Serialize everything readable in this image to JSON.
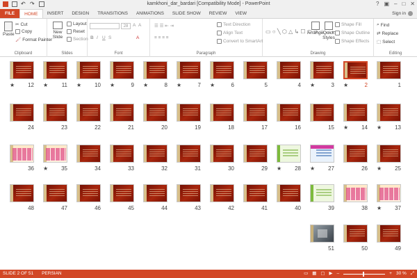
{
  "window": {
    "title": "kamkhoni_dar_bardari [Compatibility Mode] - PowerPoint"
  },
  "tabs": [
    "FILE",
    "HOME",
    "INSERT",
    "DESIGN",
    "TRANSITIONS",
    "ANIMATIONS",
    "SLIDE SHOW",
    "REVIEW",
    "VIEW"
  ],
  "account": {
    "signin": "Sign in"
  },
  "ribbon": {
    "clipboard": {
      "label": "Clipboard",
      "paste": "Paste",
      "cut": "Cut",
      "copy": "Copy",
      "format_painter": "Format Painter"
    },
    "slides": {
      "label": "Slides",
      "new_slide": "New Slide",
      "layout": "Layout",
      "reset": "Reset",
      "section": "Section"
    },
    "font": {
      "label": "Font",
      "size": "28"
    },
    "paragraph": {
      "label": "Paragraph",
      "text_direction": "Text Direction",
      "align_text": "Align Text",
      "convert": "Convert to SmartArt"
    },
    "drawing": {
      "label": "Drawing",
      "arrange": "Arrange",
      "quick_styles": "Quick Styles",
      "shape_fill": "Shape Fill",
      "shape_outline": "Shape Outline",
      "shape_effects": "Shape Effects"
    },
    "editing": {
      "label": "Editing",
      "find": "Find",
      "replace": "Replace",
      "select": "Select"
    }
  },
  "slides": [
    {
      "n": "1",
      "star": false,
      "type": "title"
    },
    {
      "n": "2",
      "star": true,
      "type": "title"
    },
    {
      "n": "3",
      "star": true,
      "type": "text"
    },
    {
      "n": "4",
      "star": false,
      "type": "text"
    },
    {
      "n": "5",
      "star": false,
      "type": "text"
    },
    {
      "n": "6",
      "star": true,
      "type": "text"
    },
    {
      "n": "7",
      "star": true,
      "type": "text"
    },
    {
      "n": "8",
      "star": true,
      "type": "text"
    },
    {
      "n": "9",
      "star": true,
      "type": "text"
    },
    {
      "n": "10",
      "star": true,
      "type": "text"
    },
    {
      "n": "11",
      "star": true,
      "type": "text"
    },
    {
      "n": "12",
      "star": true,
      "type": "text"
    },
    {
      "n": "13",
      "star": true,
      "type": "text"
    },
    {
      "n": "14",
      "star": true,
      "type": "text"
    },
    {
      "n": "15",
      "star": false,
      "type": "text"
    },
    {
      "n": "16",
      "star": false,
      "type": "text"
    },
    {
      "n": "17",
      "star": false,
      "type": "text"
    },
    {
      "n": "18",
      "star": false,
      "type": "text"
    },
    {
      "n": "19",
      "star": false,
      "type": "text"
    },
    {
      "n": "20",
      "star": false,
      "type": "text"
    },
    {
      "n": "21",
      "star": false,
      "type": "text"
    },
    {
      "n": "22",
      "star": false,
      "type": "text"
    },
    {
      "n": "23",
      "star": false,
      "type": "text"
    },
    {
      "n": "24",
      "star": false,
      "type": "text"
    },
    {
      "n": "25",
      "star": true,
      "type": "text"
    },
    {
      "n": "26",
      "star": false,
      "type": "text"
    },
    {
      "n": "27",
      "star": true,
      "type": "blue"
    },
    {
      "n": "28",
      "star": true,
      "type": "green"
    },
    {
      "n": "29",
      "star": false,
      "type": "text"
    },
    {
      "n": "30",
      "star": false,
      "type": "text"
    },
    {
      "n": "31",
      "star": false,
      "type": "text"
    },
    {
      "n": "32",
      "star": false,
      "type": "text"
    },
    {
      "n": "33",
      "star": false,
      "type": "text"
    },
    {
      "n": "34",
      "star": false,
      "type": "text"
    },
    {
      "n": "35",
      "star": true,
      "type": "table"
    },
    {
      "n": "36",
      "star": false,
      "type": "table"
    },
    {
      "n": "37",
      "star": true,
      "type": "table"
    },
    {
      "n": "38",
      "star": false,
      "type": "table"
    },
    {
      "n": "39",
      "star": false,
      "type": "green"
    },
    {
      "n": "40",
      "star": false,
      "type": "text"
    },
    {
      "n": "41",
      "star": false,
      "type": "text"
    },
    {
      "n": "42",
      "star": false,
      "type": "text"
    },
    {
      "n": "43",
      "star": false,
      "type": "text"
    },
    {
      "n": "44",
      "star": false,
      "type": "text"
    },
    {
      "n": "45",
      "star": false,
      "type": "text"
    },
    {
      "n": "46",
      "star": false,
      "type": "text"
    },
    {
      "n": "47",
      "star": false,
      "type": "text"
    },
    {
      "n": "48",
      "star": false,
      "type": "text"
    },
    {
      "n": "49",
      "star": false,
      "type": "text"
    },
    {
      "n": "50",
      "star": false,
      "type": "text"
    },
    {
      "n": "51",
      "star": false,
      "type": "photo"
    }
  ],
  "selected_slide": "2",
  "status": {
    "slide": "SLIDE 2 OF 51",
    "language": "PERSIAN",
    "zoom": "30 %"
  }
}
